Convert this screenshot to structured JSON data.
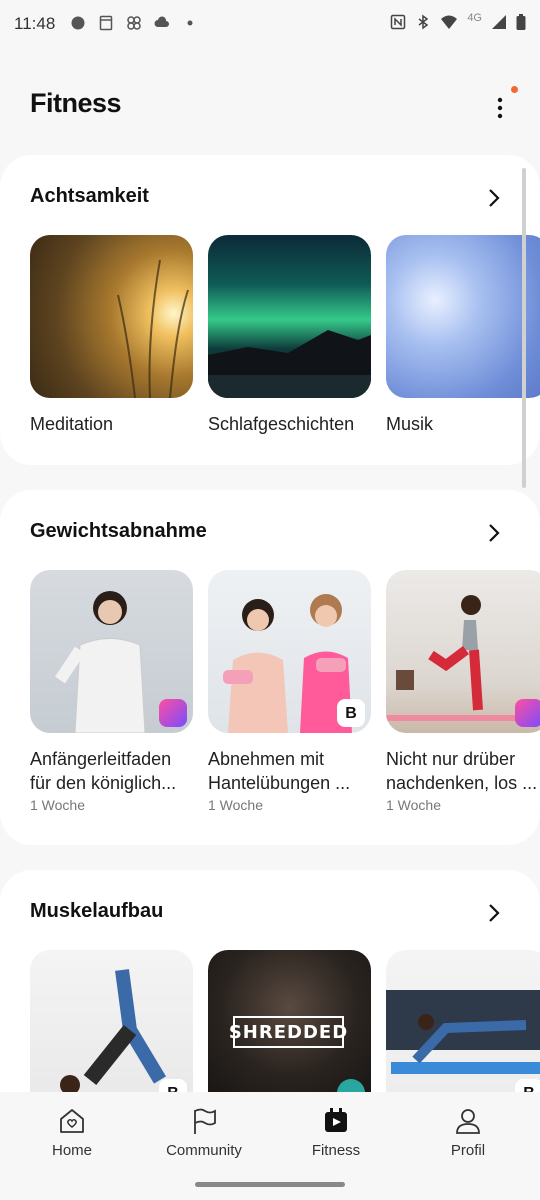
{
  "status": {
    "time": "11:48",
    "network": "4G"
  },
  "header": {
    "title": "Fitness"
  },
  "sections": [
    {
      "title": "Achtsamkeit",
      "items": [
        {
          "label": "Meditation"
        },
        {
          "label": "Schlafgeschichten"
        },
        {
          "label": "Musik"
        }
      ]
    },
    {
      "title": "Gewichtsabnahme",
      "items": [
        {
          "line1": "Anfängerleitfaden",
          "line2": "für den königlich...",
          "sub": "1 Woche"
        },
        {
          "line1": "Abnehmen mit",
          "line2": "Hantelübungen ...",
          "sub": "1 Woche"
        },
        {
          "line1": "Nicht nur drüber",
          "line2": "nachdenken, los ...",
          "sub": "1 Woche"
        }
      ]
    },
    {
      "title": "Muskelaufbau",
      "items": [
        {
          "label": ""
        },
        {
          "overlay": "SHREDDED"
        },
        {
          "label": ""
        }
      ]
    }
  ],
  "nav": [
    {
      "label": "Home",
      "icon": "home-heart-icon"
    },
    {
      "label": "Community",
      "icon": "flag-icon"
    },
    {
      "label": "Fitness",
      "icon": "fitness-calendar-icon",
      "active": true
    },
    {
      "label": "Profil",
      "icon": "profile-icon"
    }
  ],
  "colors": {
    "accent_dot": "#f26a2e",
    "text": "#111111",
    "background": "#f7f7f7"
  }
}
